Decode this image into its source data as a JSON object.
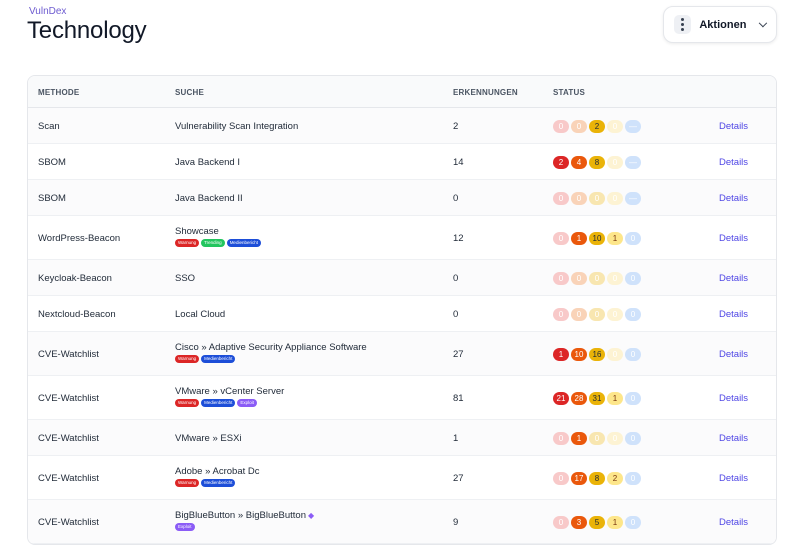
{
  "breadcrumb": "VulnDex",
  "title": "Technology",
  "actions": {
    "label": "Aktionen"
  },
  "columns": {
    "method": "METHODE",
    "search": "SUCHE",
    "detections": "ERKENNUNGEN",
    "status": "STATUS"
  },
  "details_label": "Details",
  "tag_styles": {
    "Warnung": "#dc2626",
    "Trending": "#22c55e",
    "Medienbericht": "#1d4ed8",
    "Exploit": "#8b5cf6"
  },
  "rows": [
    {
      "method": "Scan",
      "search": "Vulnerability Scan Integration",
      "tags": [],
      "detections": "2",
      "status": [
        "0",
        "0",
        "2",
        "0",
        "—"
      ],
      "details": "Details"
    },
    {
      "method": "SBOM",
      "search": "Java Backend I",
      "tags": [],
      "detections": "14",
      "status": [
        "2",
        "4",
        "8",
        "0",
        "—"
      ],
      "details": "Details"
    },
    {
      "method": "SBOM",
      "search": "Java Backend II",
      "tags": [],
      "detections": "0",
      "status": [
        "0",
        "0",
        "0",
        "0",
        "—"
      ],
      "details": "Details"
    },
    {
      "method": "WordPress-Beacon",
      "search": "Showcase",
      "tags": [
        "Warnung",
        "Trending",
        "Medienbericht"
      ],
      "detections": "12",
      "status": [
        "0",
        "1",
        "10",
        "1",
        "0"
      ],
      "details": "Details"
    },
    {
      "method": "Keycloak-Beacon",
      "search": "SSO",
      "tags": [],
      "detections": "0",
      "status": [
        "0",
        "0",
        "0",
        "0",
        "0"
      ],
      "details": "Details"
    },
    {
      "method": "Nextcloud-Beacon",
      "search": "Local Cloud",
      "tags": [],
      "detections": "0",
      "status": [
        "0",
        "0",
        "0",
        "0",
        "0"
      ],
      "details": "Details"
    },
    {
      "method": "CVE-Watchlist",
      "search": "Cisco » Adaptive Security Appliance Software",
      "tags": [
        "Warnung",
        "Medienbericht"
      ],
      "detections": "27",
      "status": [
        "1",
        "10",
        "16",
        "0",
        "0"
      ],
      "details": "Details"
    },
    {
      "method": "CVE-Watchlist",
      "search": "VMware » vCenter Server",
      "tags": [
        "Warnung",
        "Medienbericht",
        "Exploit"
      ],
      "detections": "81",
      "status": [
        "21",
        "28",
        "31",
        "1",
        "0"
      ],
      "details": "Details"
    },
    {
      "method": "CVE-Watchlist",
      "search": "VMware » ESXi",
      "tags": [],
      "detections": "1",
      "status": [
        "0",
        "1",
        "0",
        "0",
        "0"
      ],
      "details": "Details"
    },
    {
      "method": "CVE-Watchlist",
      "search": "Adobe » Acrobat Dc",
      "tags": [
        "Warnung",
        "Medienbericht"
      ],
      "detections": "27",
      "status": [
        "0",
        "17",
        "8",
        "2",
        "0"
      ],
      "details": "Details"
    },
    {
      "method": "CVE-Watchlist",
      "search": "BigBlueButton » BigBlueButton",
      "search_icon": "gem-icon",
      "tags": [
        "Exploit"
      ],
      "detections": "9",
      "status": [
        "0",
        "3",
        "5",
        "1",
        "0"
      ],
      "details": "Details"
    }
  ]
}
